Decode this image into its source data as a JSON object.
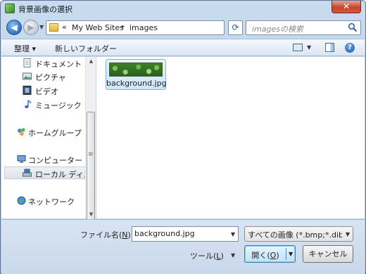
{
  "window": {
    "title": "背景画像の選択",
    "close_glyph": "✕"
  },
  "address": {
    "back_glyph": "◀",
    "forward_glyph": "▶",
    "more_glyph": "«",
    "crumbs": [
      "My Web Sites",
      "images"
    ],
    "separator_glyph": "▸",
    "search_placeholder": "imagesの検索",
    "refresh_glyph": "⟳"
  },
  "toolbar": {
    "organize_label": "整理 ▾",
    "new_folder_label": "新しいフォルダー",
    "help_glyph": "?"
  },
  "nav": {
    "items": [
      {
        "label": "ドキュメント",
        "icon": "document-icon"
      },
      {
        "label": "ピクチャ",
        "icon": "pictures-icon"
      },
      {
        "label": "ビデオ",
        "icon": "video-icon"
      },
      {
        "label": "ミュージック",
        "icon": "music-icon"
      },
      {
        "label": "ホームグループ",
        "icon": "homegroup-icon"
      },
      {
        "label": "コンピューター",
        "icon": "computer-icon"
      },
      {
        "label": "ローカル ディス",
        "icon": "local-disk-icon",
        "selected": true
      },
      {
        "label": "ネットワーク",
        "icon": "network-icon"
      }
    ]
  },
  "files": [
    {
      "name": "background.jpg",
      "icon": "image-thumbnail"
    }
  ],
  "bottom": {
    "filename_label_pre": "ファイル名(",
    "filename_label_key": "N",
    "filename_label_post": "):",
    "filename_value": "background.jpg",
    "filter_value": "すべての画像 (*.bmp;*.dib;*",
    "tools_pre": "ツール(",
    "tools_key": "L",
    "tools_post": ")",
    "open_pre": "開く(",
    "open_key": "O",
    "open_post": ")",
    "cancel_label": "キャンセル"
  },
  "colors": {
    "accent": "#3c7fb1",
    "chrome": "#c9dbee",
    "close": "#c7452b"
  }
}
